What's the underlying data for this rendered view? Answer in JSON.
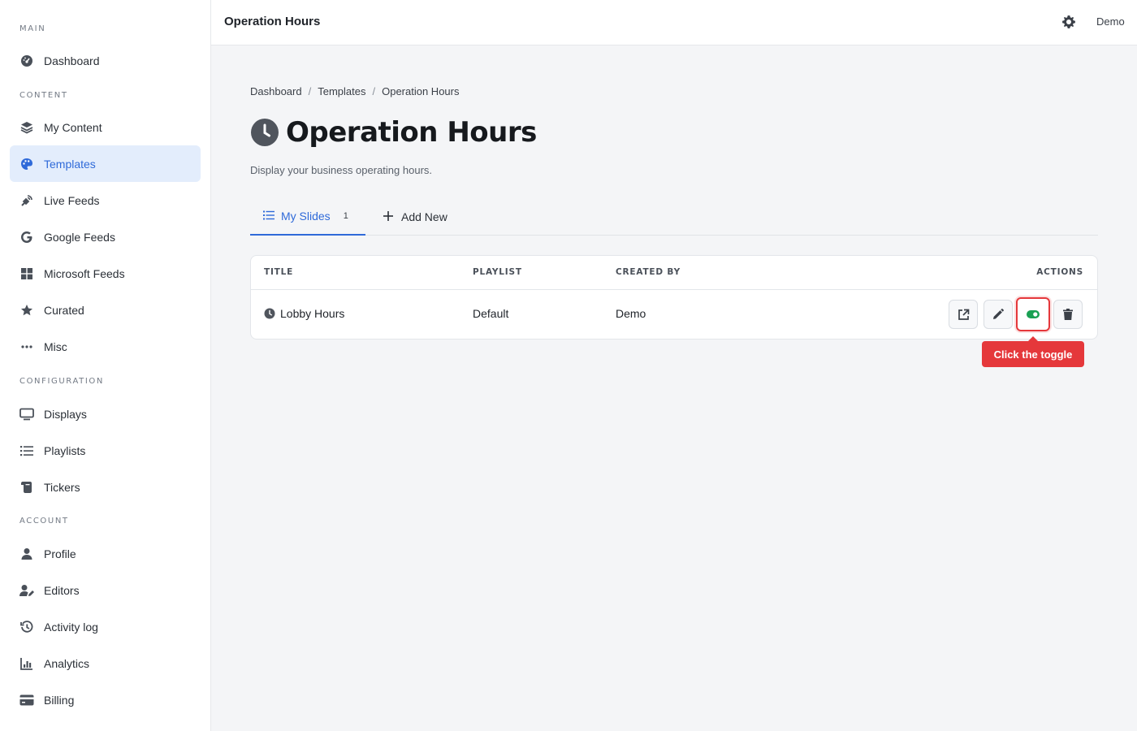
{
  "topbar": {
    "title": "Operation Hours",
    "user": "Demo"
  },
  "sidebar": {
    "sections": [
      {
        "label": "MAIN",
        "items": [
          {
            "label": "Dashboard",
            "icon": "dashboard-icon"
          }
        ]
      },
      {
        "label": "CONTENT",
        "items": [
          {
            "label": "My Content",
            "icon": "layers-icon"
          },
          {
            "label": "Templates",
            "icon": "palette-icon",
            "active": true
          },
          {
            "label": "Live Feeds",
            "icon": "satellite-icon"
          },
          {
            "label": "Google Feeds",
            "icon": "google-icon"
          },
          {
            "label": "Microsoft Feeds",
            "icon": "windows-icon"
          },
          {
            "label": "Curated",
            "icon": "star-icon"
          },
          {
            "label": "Misc",
            "icon": "ellipsis-icon"
          }
        ]
      },
      {
        "label": "CONFIGURATION",
        "items": [
          {
            "label": "Displays",
            "icon": "monitor-icon"
          },
          {
            "label": "Playlists",
            "icon": "list-icon"
          },
          {
            "label": "Tickers",
            "icon": "scroll-icon"
          }
        ]
      },
      {
        "label": "ACCOUNT",
        "items": [
          {
            "label": "Profile",
            "icon": "user-icon"
          },
          {
            "label": "Editors",
            "icon": "user-edit-icon"
          },
          {
            "label": "Activity log",
            "icon": "history-icon"
          },
          {
            "label": "Analytics",
            "icon": "chart-icon"
          },
          {
            "label": "Billing",
            "icon": "credit-card-icon"
          }
        ]
      }
    ]
  },
  "breadcrumb": [
    "Dashboard",
    "Templates",
    "Operation Hours"
  ],
  "page": {
    "title": "Operation Hours",
    "subtitle": "Display your business operating hours."
  },
  "tabs": [
    {
      "label": "My Slides",
      "count": "1",
      "active": true
    },
    {
      "label": "Add New"
    }
  ],
  "table": {
    "headers": [
      "TITLE",
      "PLAYLIST",
      "CREATED BY",
      "ACTIONS"
    ],
    "rows": [
      {
        "title": "Lobby Hours",
        "playlist": "Default",
        "created_by": "Demo",
        "enabled": true
      }
    ]
  },
  "tooltip": "Click the toggle",
  "colors": {
    "accent": "#2f6ad9",
    "danger": "#e5383b",
    "toggle_on": "#1aa053"
  }
}
